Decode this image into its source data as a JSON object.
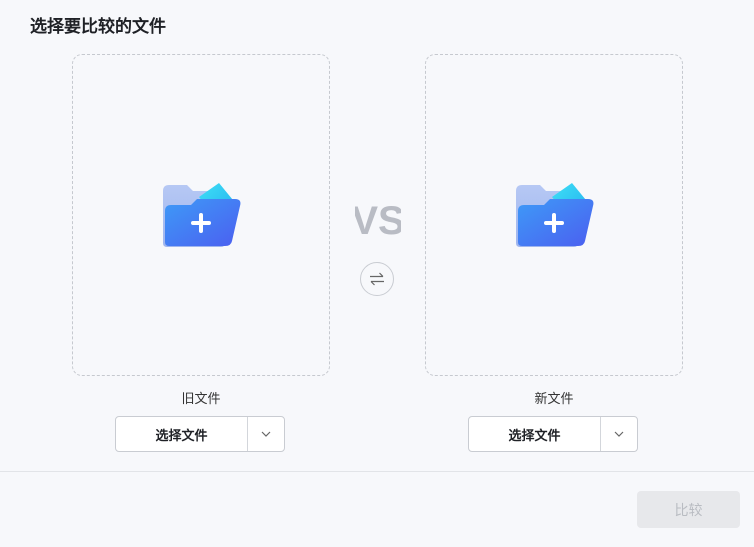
{
  "header": {
    "title": "选择要比较的文件"
  },
  "old_file": {
    "label": "旧文件",
    "choose_label": "选择文件"
  },
  "new_file": {
    "label": "新文件",
    "choose_label": "选择文件"
  },
  "vs_text": "VS",
  "footer": {
    "compare_label": "比较"
  },
  "colors": {
    "accent_blue": "#3b6ef5",
    "accent_cyan": "#2ec7f0",
    "vs_gray": "#b9bcc4",
    "disabled_bg": "#e7e8eb"
  },
  "icons": {
    "drop_zone": "folder-add-icon",
    "swap": "swap-arrows-icon",
    "dropdown": "chevron-down-icon"
  }
}
